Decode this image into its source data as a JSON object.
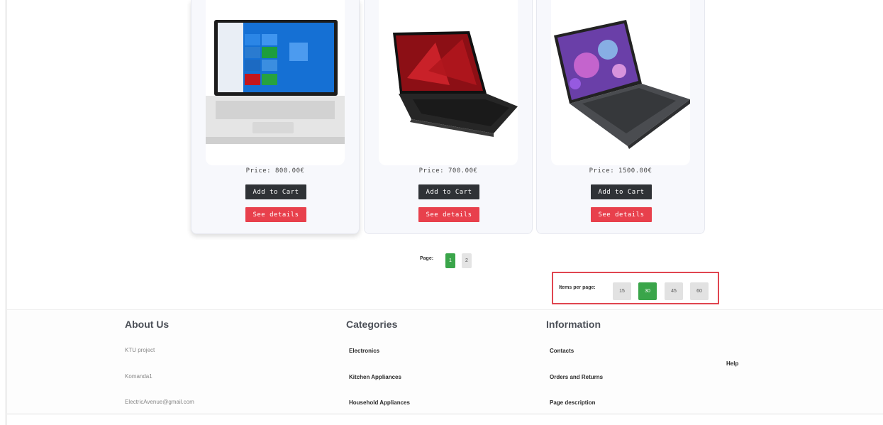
{
  "products": [
    {
      "price": "Price: 800.00€",
      "add_label": "Add to Cart",
      "details_label": "See details"
    },
    {
      "price": "Price: 700.00€",
      "add_label": "Add to Cart",
      "details_label": "See details"
    },
    {
      "price": "Price: 1500.00€",
      "add_label": "Add to Cart",
      "details_label": "See details"
    }
  ],
  "pagination": {
    "label": "Page:",
    "pages": [
      "1",
      "2"
    ],
    "current": "1"
  },
  "items_per_page": {
    "label": "Items per page:",
    "options": [
      "15",
      "30",
      "45",
      "60"
    ],
    "selected": "30"
  },
  "footer": {
    "about": {
      "title": "About Us",
      "items": [
        "KTU project",
        "Komanda1",
        "ElectricAvenue@gmail.com"
      ]
    },
    "categories": {
      "title": "Categories",
      "items": [
        "Electronics",
        "Kitchen Appliances",
        "Household Appliances"
      ]
    },
    "information": {
      "title": "Information",
      "items": [
        "Contacts",
        "Orders and Returns",
        "Page description"
      ],
      "help": "Help"
    }
  },
  "colors": {
    "primary_dark": "#2f3236",
    "danger": "#e8404c",
    "success": "#3aa54a",
    "highlight_border": "#e04550"
  },
  "icons": [
    "laptop-image-hp",
    "laptop-image-acer",
    "laptop-image-dell"
  ]
}
